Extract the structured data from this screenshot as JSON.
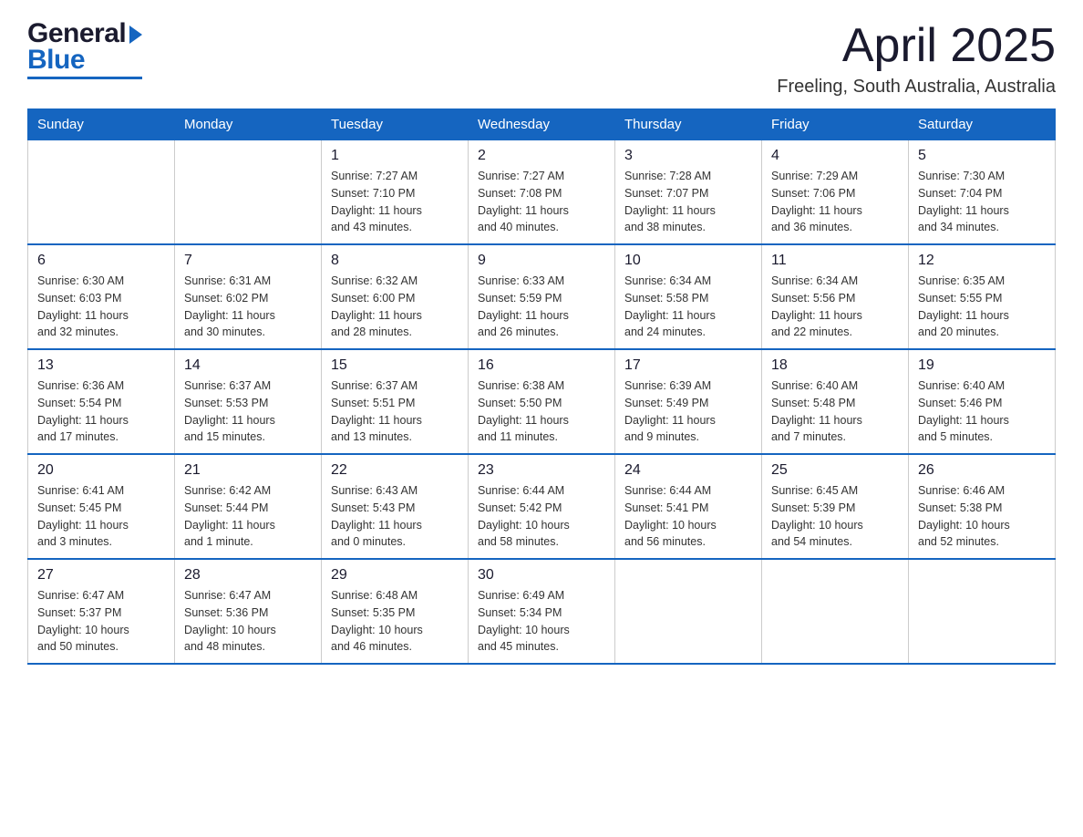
{
  "header": {
    "logo_general": "General",
    "logo_blue": "Blue",
    "month_title": "April 2025",
    "location": "Freeling, South Australia, Australia"
  },
  "columns": [
    "Sunday",
    "Monday",
    "Tuesday",
    "Wednesday",
    "Thursday",
    "Friday",
    "Saturday"
  ],
  "weeks": [
    [
      {
        "day": "",
        "info": ""
      },
      {
        "day": "",
        "info": ""
      },
      {
        "day": "1",
        "info": "Sunrise: 7:27 AM\nSunset: 7:10 PM\nDaylight: 11 hours\nand 43 minutes."
      },
      {
        "day": "2",
        "info": "Sunrise: 7:27 AM\nSunset: 7:08 PM\nDaylight: 11 hours\nand 40 minutes."
      },
      {
        "day": "3",
        "info": "Sunrise: 7:28 AM\nSunset: 7:07 PM\nDaylight: 11 hours\nand 38 minutes."
      },
      {
        "day": "4",
        "info": "Sunrise: 7:29 AM\nSunset: 7:06 PM\nDaylight: 11 hours\nand 36 minutes."
      },
      {
        "day": "5",
        "info": "Sunrise: 7:30 AM\nSunset: 7:04 PM\nDaylight: 11 hours\nand 34 minutes."
      }
    ],
    [
      {
        "day": "6",
        "info": "Sunrise: 6:30 AM\nSunset: 6:03 PM\nDaylight: 11 hours\nand 32 minutes."
      },
      {
        "day": "7",
        "info": "Sunrise: 6:31 AM\nSunset: 6:02 PM\nDaylight: 11 hours\nand 30 minutes."
      },
      {
        "day": "8",
        "info": "Sunrise: 6:32 AM\nSunset: 6:00 PM\nDaylight: 11 hours\nand 28 minutes."
      },
      {
        "day": "9",
        "info": "Sunrise: 6:33 AM\nSunset: 5:59 PM\nDaylight: 11 hours\nand 26 minutes."
      },
      {
        "day": "10",
        "info": "Sunrise: 6:34 AM\nSunset: 5:58 PM\nDaylight: 11 hours\nand 24 minutes."
      },
      {
        "day": "11",
        "info": "Sunrise: 6:34 AM\nSunset: 5:56 PM\nDaylight: 11 hours\nand 22 minutes."
      },
      {
        "day": "12",
        "info": "Sunrise: 6:35 AM\nSunset: 5:55 PM\nDaylight: 11 hours\nand 20 minutes."
      }
    ],
    [
      {
        "day": "13",
        "info": "Sunrise: 6:36 AM\nSunset: 5:54 PM\nDaylight: 11 hours\nand 17 minutes."
      },
      {
        "day": "14",
        "info": "Sunrise: 6:37 AM\nSunset: 5:53 PM\nDaylight: 11 hours\nand 15 minutes."
      },
      {
        "day": "15",
        "info": "Sunrise: 6:37 AM\nSunset: 5:51 PM\nDaylight: 11 hours\nand 13 minutes."
      },
      {
        "day": "16",
        "info": "Sunrise: 6:38 AM\nSunset: 5:50 PM\nDaylight: 11 hours\nand 11 minutes."
      },
      {
        "day": "17",
        "info": "Sunrise: 6:39 AM\nSunset: 5:49 PM\nDaylight: 11 hours\nand 9 minutes."
      },
      {
        "day": "18",
        "info": "Sunrise: 6:40 AM\nSunset: 5:48 PM\nDaylight: 11 hours\nand 7 minutes."
      },
      {
        "day": "19",
        "info": "Sunrise: 6:40 AM\nSunset: 5:46 PM\nDaylight: 11 hours\nand 5 minutes."
      }
    ],
    [
      {
        "day": "20",
        "info": "Sunrise: 6:41 AM\nSunset: 5:45 PM\nDaylight: 11 hours\nand 3 minutes."
      },
      {
        "day": "21",
        "info": "Sunrise: 6:42 AM\nSunset: 5:44 PM\nDaylight: 11 hours\nand 1 minute."
      },
      {
        "day": "22",
        "info": "Sunrise: 6:43 AM\nSunset: 5:43 PM\nDaylight: 11 hours\nand 0 minutes."
      },
      {
        "day": "23",
        "info": "Sunrise: 6:44 AM\nSunset: 5:42 PM\nDaylight: 10 hours\nand 58 minutes."
      },
      {
        "day": "24",
        "info": "Sunrise: 6:44 AM\nSunset: 5:41 PM\nDaylight: 10 hours\nand 56 minutes."
      },
      {
        "day": "25",
        "info": "Sunrise: 6:45 AM\nSunset: 5:39 PM\nDaylight: 10 hours\nand 54 minutes."
      },
      {
        "day": "26",
        "info": "Sunrise: 6:46 AM\nSunset: 5:38 PM\nDaylight: 10 hours\nand 52 minutes."
      }
    ],
    [
      {
        "day": "27",
        "info": "Sunrise: 6:47 AM\nSunset: 5:37 PM\nDaylight: 10 hours\nand 50 minutes."
      },
      {
        "day": "28",
        "info": "Sunrise: 6:47 AM\nSunset: 5:36 PM\nDaylight: 10 hours\nand 48 minutes."
      },
      {
        "day": "29",
        "info": "Sunrise: 6:48 AM\nSunset: 5:35 PM\nDaylight: 10 hours\nand 46 minutes."
      },
      {
        "day": "30",
        "info": "Sunrise: 6:49 AM\nSunset: 5:34 PM\nDaylight: 10 hours\nand 45 minutes."
      },
      {
        "day": "",
        "info": ""
      },
      {
        "day": "",
        "info": ""
      },
      {
        "day": "",
        "info": ""
      }
    ]
  ]
}
